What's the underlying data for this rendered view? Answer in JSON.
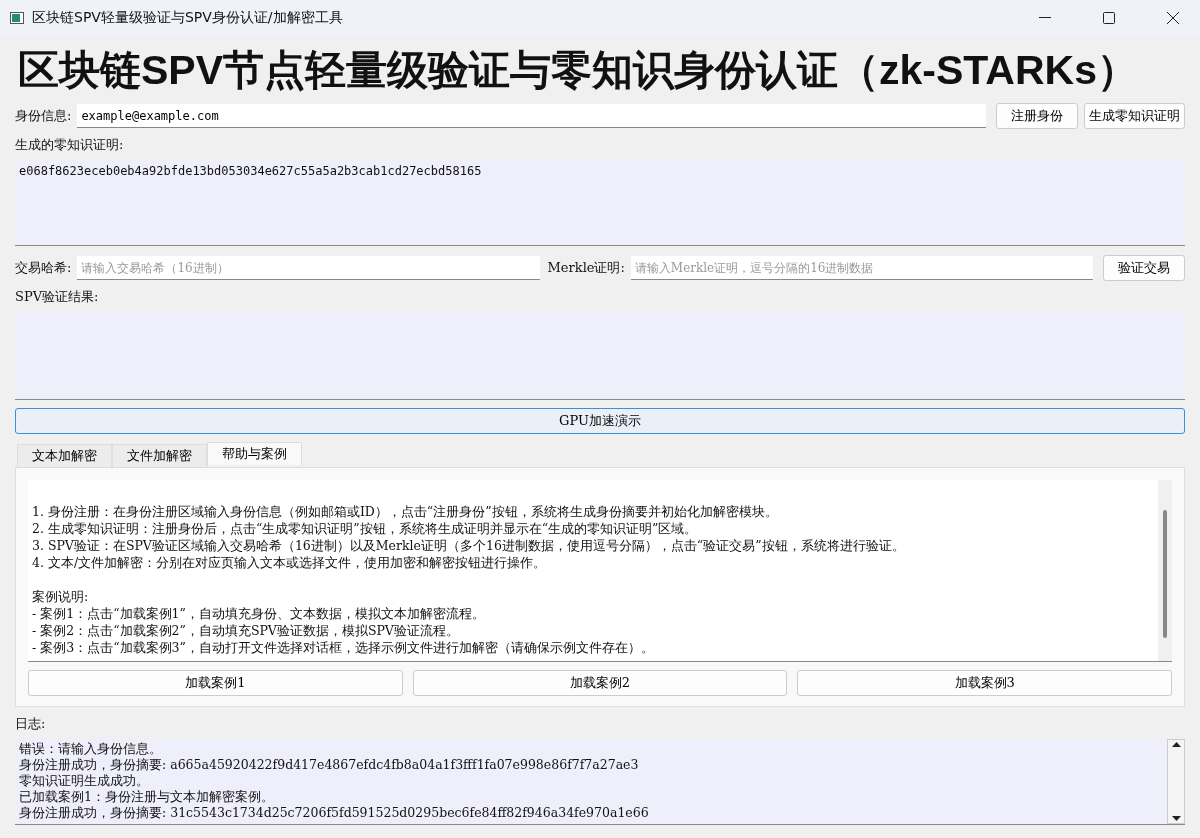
{
  "window": {
    "title": "区块链SPV轻量级验证与SPV身份认证/加解密工具"
  },
  "heading": "区块链SPV节点轻量级验证与零知识身份认证（zk-STARKs）",
  "identity": {
    "label": "身份信息:",
    "value": "example@example.com",
    "buttons": [
      "注册身份",
      "生成零知识证明"
    ]
  },
  "proof": {
    "label": "生成的零知识证明:",
    "value": "e068f8623eceb0eb4a92bfde13bd053034e627c55a5a2b3cab1cd27ecbd58165"
  },
  "transaction": {
    "hash_label": "交易哈希:",
    "hash_placeholder": "请输入交易哈希（16进制）",
    "merkle_label": "Merkle证明:",
    "merkle_placeholder": "请输入Merkle证明，逗号分隔的16进制数据",
    "button": "验证交易"
  },
  "spv_result": {
    "label": "SPV验证结果:"
  },
  "gpu_button": "GPU加速演示",
  "tabs": [
    {
      "label": "文本加解密",
      "selected": false
    },
    {
      "label": "文件加解密",
      "selected": false
    },
    {
      "label": "帮助与案例",
      "selected": true
    }
  ],
  "help": {
    "sections": [
      {
        "lines": [
          "1. 身份注册：在身份注册区域输入身份信息（例如邮箱或ID），点击“注册身份”按钮，系统将生成身份摘要并初始化加解密模块。",
          "2. 生成零知识证明：注册身份后，点击“生成零知识证明”按钮，系统将生成证明并显示在“生成的零知识证明”区域。",
          "3. SPV验证：在SPV验证区域输入交易哈希（16进制）以及Merkle证明（多个16进制数据，使用逗号分隔），点击“验证交易”按钮，系统将进行验证。",
          "4. 文本/文件加解密：分别在对应页输入文本或选择文件，使用加密和解密按钮进行操作。"
        ]
      },
      {
        "lines": [
          "案例说明:",
          "- 案例1：点击“加载案例1”，自动填充身份、文本数据，模拟文本加解密流程。",
          "- 案例2：点击“加载案例2”，自动填充SPV验证数据，模拟SPV验证流程。",
          "- 案例3：点击“加载案例3”，自动打开文件选择对话框，选择示例文件进行加解密（请确保示例文件存在）。"
        ]
      }
    ],
    "buttons": [
      "加载案例1",
      "加载案例2",
      "加载案例3"
    ]
  },
  "log": {
    "label": "日志:",
    "lines": [
      "错误：请输入身份信息。",
      "身份注册成功，身份摘要: a665a45920422f9d417e4867efdc4fb8a04a1f3fff1fa07e998e86f7f7a27ae3",
      "零知识证明生成成功。",
      "已加载案例1：身份注册与文本加解密案例。",
      "身份注册成功，身份摘要: 31c5543c1734d25c7206f5fd591525d0295bec6fe84ff82f946a34fe970a1e66"
    ]
  }
}
